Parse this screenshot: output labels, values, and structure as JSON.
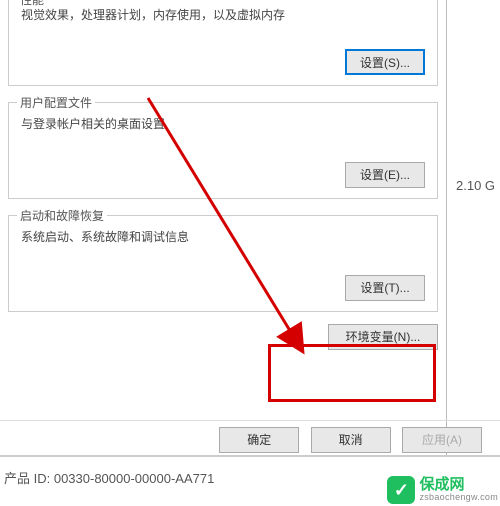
{
  "performance": {
    "title": "性能",
    "desc": "视觉效果，处理器计划，内存使用，以及虚拟内存",
    "button": "设置(S)..."
  },
  "userProfile": {
    "title": "用户配置文件",
    "desc": "与登录帐户相关的桌面设置",
    "button": "设置(E)..."
  },
  "startupRecovery": {
    "title": "启动和故障恢复",
    "desc": "系统启动、系统故障和调试信息",
    "button": "设置(T)..."
  },
  "envVars": {
    "button": "环境变量(N)..."
  },
  "dialogButtons": {
    "ok": "确定",
    "cancel": "取消",
    "apply": "应用(A)"
  },
  "rightPanel": {
    "ghz": "2.10 G"
  },
  "productId": {
    "label": "产品 ID: 00330-80000-00000-AA771"
  },
  "watermark": {
    "badge": "✓",
    "name": "保成网",
    "domain": "zsbaochengw.com"
  }
}
